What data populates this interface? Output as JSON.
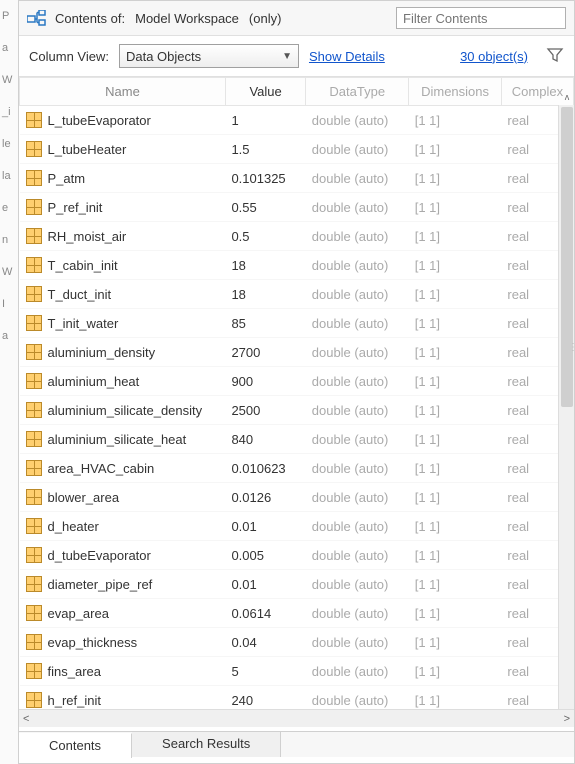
{
  "header": {
    "contents_of": "Contents of:",
    "workspace": "Model Workspace",
    "scope": "(only)",
    "filter_placeholder": "Filter Contents"
  },
  "toolbar": {
    "column_view_label": "Column View:",
    "dropdown_value": "Data Objects",
    "show_details": "Show Details",
    "object_count": "30 object(s)"
  },
  "columns": {
    "name": "Name",
    "value": "Value",
    "datatype": "DataType",
    "dimensions": "Dimensions",
    "complex": "Complex"
  },
  "rows": [
    {
      "name": "L_tubeEvaporator",
      "value": "1",
      "datatype": "double (auto)",
      "dim": "[1 1]",
      "cx": "real"
    },
    {
      "name": "L_tubeHeater",
      "value": "1.5",
      "datatype": "double (auto)",
      "dim": "[1 1]",
      "cx": "real"
    },
    {
      "name": "P_atm",
      "value": "0.101325",
      "datatype": "double (auto)",
      "dim": "[1 1]",
      "cx": "real"
    },
    {
      "name": "P_ref_init",
      "value": "0.55",
      "datatype": "double (auto)",
      "dim": "[1 1]",
      "cx": "real"
    },
    {
      "name": "RH_moist_air",
      "value": "0.5",
      "datatype": "double (auto)",
      "dim": "[1 1]",
      "cx": "real"
    },
    {
      "name": "T_cabin_init",
      "value": "18",
      "datatype": "double (auto)",
      "dim": "[1 1]",
      "cx": "real"
    },
    {
      "name": "T_duct_init",
      "value": "18",
      "datatype": "double (auto)",
      "dim": "[1 1]",
      "cx": "real"
    },
    {
      "name": "T_init_water",
      "value": "85",
      "datatype": "double (auto)",
      "dim": "[1 1]",
      "cx": "real"
    },
    {
      "name": "aluminium_density",
      "value": "2700",
      "datatype": "double (auto)",
      "dim": "[1 1]",
      "cx": "real"
    },
    {
      "name": "aluminium_heat",
      "value": "900",
      "datatype": "double (auto)",
      "dim": "[1 1]",
      "cx": "real"
    },
    {
      "name": "aluminium_silicate_density",
      "value": "2500",
      "datatype": "double (auto)",
      "dim": "[1 1]",
      "cx": "real"
    },
    {
      "name": "aluminium_silicate_heat",
      "value": "840",
      "datatype": "double (auto)",
      "dim": "[1 1]",
      "cx": "real"
    },
    {
      "name": "area_HVAC_cabin",
      "value": "0.010623",
      "datatype": "double (auto)",
      "dim": "[1 1]",
      "cx": "real"
    },
    {
      "name": "blower_area",
      "value": "0.0126",
      "datatype": "double (auto)",
      "dim": "[1 1]",
      "cx": "real"
    },
    {
      "name": "d_heater",
      "value": "0.01",
      "datatype": "double (auto)",
      "dim": "[1 1]",
      "cx": "real"
    },
    {
      "name": "d_tubeEvaporator",
      "value": "0.005",
      "datatype": "double (auto)",
      "dim": "[1 1]",
      "cx": "real"
    },
    {
      "name": "diameter_pipe_ref",
      "value": "0.01",
      "datatype": "double (auto)",
      "dim": "[1 1]",
      "cx": "real"
    },
    {
      "name": "evap_area",
      "value": "0.0614",
      "datatype": "double (auto)",
      "dim": "[1 1]",
      "cx": "real"
    },
    {
      "name": "evap_thickness",
      "value": "0.04",
      "datatype": "double (auto)",
      "dim": "[1 1]",
      "cx": "real"
    },
    {
      "name": "fins_area",
      "value": "5",
      "datatype": "double (auto)",
      "dim": "[1 1]",
      "cx": "real"
    },
    {
      "name": "h_ref_init",
      "value": "240",
      "datatype": "double (auto)",
      "dim": "[1 1]",
      "cx": "real"
    }
  ],
  "tabs": {
    "contents": "Contents",
    "search": "Search Results"
  }
}
